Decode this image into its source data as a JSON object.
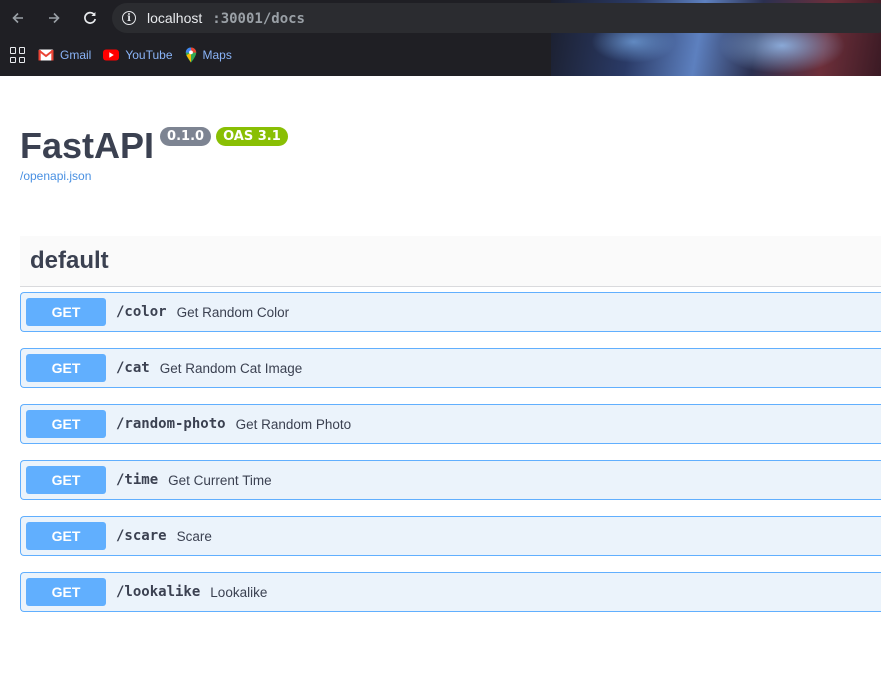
{
  "browser": {
    "url_host": "localhost",
    "url_path": ":30001/docs",
    "bookmarks": [
      {
        "label": "Gmail",
        "icon": "gmail-icon"
      },
      {
        "label": "YouTube",
        "icon": "youtube-icon"
      },
      {
        "label": "Maps",
        "icon": "maps-icon"
      }
    ]
  },
  "api": {
    "title": "FastAPI",
    "version": "0.1.0",
    "oas": "OAS 3.1",
    "spec_link": "/openapi.json"
  },
  "section": {
    "tag": "default",
    "operations": [
      {
        "method": "GET",
        "path": "/color",
        "summary": "Get Random Color"
      },
      {
        "method": "GET",
        "path": "/cat",
        "summary": "Get Random Cat Image"
      },
      {
        "method": "GET",
        "path": "/random-photo",
        "summary": "Get Random Photo"
      },
      {
        "method": "GET",
        "path": "/time",
        "summary": "Get Current Time"
      },
      {
        "method": "GET",
        "path": "/scare",
        "summary": "Scare"
      },
      {
        "method": "GET",
        "path": "/lookalike",
        "summary": "Lookalike"
      }
    ]
  },
  "colors": {
    "get_method": "#61affe",
    "get_background": "#ebf3fb",
    "version_badge": "#7d8492",
    "oas_badge": "#89bf04",
    "link": "#4990e2"
  }
}
